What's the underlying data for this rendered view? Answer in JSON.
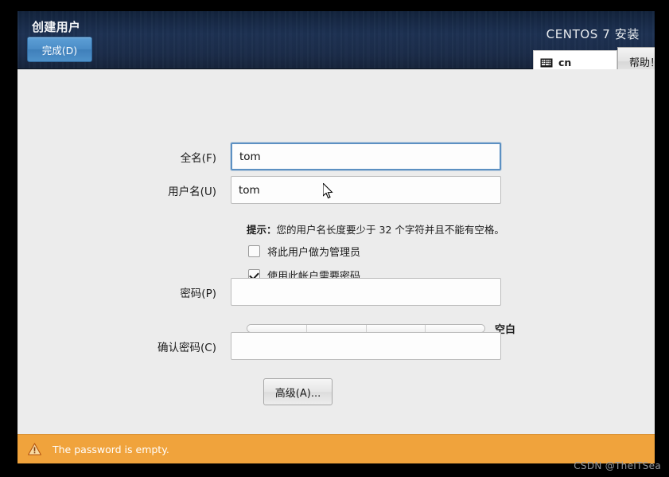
{
  "header": {
    "page_title": "创建用户",
    "done_label": "完成(D)",
    "product_title": "CENTOS 7 安装",
    "keyboard_layout": "cn",
    "keyboard_icon": "keyboard-icon",
    "help_label": "帮助！"
  },
  "form": {
    "fullname": {
      "label": "全名(F)",
      "value": "tom",
      "placeholder": "",
      "focused": true
    },
    "username": {
      "label": "用户名(U)",
      "value": "tom",
      "placeholder": "",
      "focused": false
    },
    "hint_prefix": "提示：",
    "hint_body": "您的用户名长度要少于 32 个字符并且不能有空格。",
    "admin_checkbox": {
      "label": "将此用户做为管理员",
      "checked": false
    },
    "password_required_checkbox": {
      "label": "使用此帐户需要密码",
      "checked": true
    },
    "password": {
      "label": "密码(P)",
      "value": "",
      "placeholder": ""
    },
    "strength": {
      "label": "空白",
      "segments": 4,
      "filled": 0
    },
    "confirm_password": {
      "label": "确认密码(C)",
      "value": "",
      "placeholder": ""
    },
    "advanced_label": "高级(A)..."
  },
  "warning": {
    "icon": "warning-triangle-icon",
    "message": "The password is empty."
  },
  "watermark": {
    "text": "CSDN @TheITSea"
  },
  "colors": {
    "header_bg": "#1d3152",
    "done_button": "#4a8cc6",
    "warning_bg": "#f0a33c",
    "content_bg": "#ececec",
    "focus_border": "#5c90c2"
  }
}
